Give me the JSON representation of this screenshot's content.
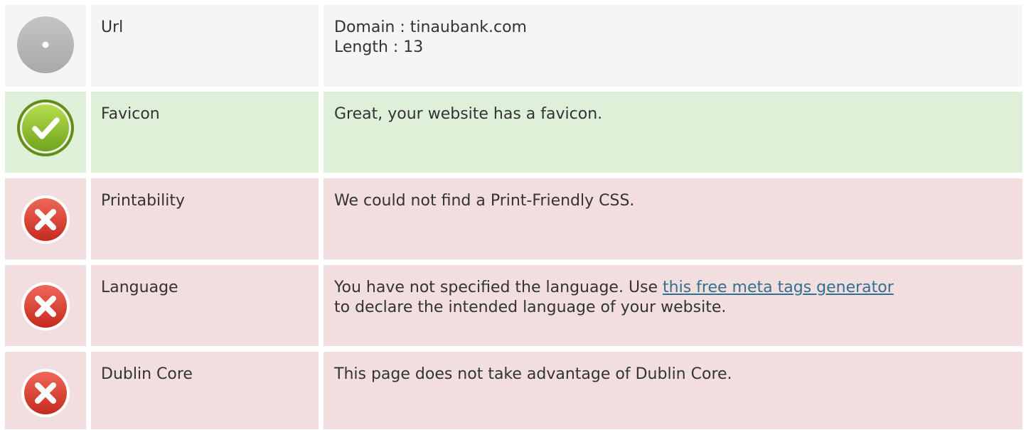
{
  "rows": [
    {
      "status": "neutral",
      "icon": "neutral-disc-icon",
      "label": "Url",
      "value_lines": [
        "Domain : tinaubank.com",
        "Length : 13"
      ]
    },
    {
      "status": "pass",
      "icon": "check-icon",
      "label": "Favicon",
      "value": "Great, your website has a favicon."
    },
    {
      "status": "fail",
      "icon": "error-x-icon",
      "label": "Printability",
      "value": "We could not find a Print-Friendly CSS."
    },
    {
      "status": "fail",
      "icon": "error-x-icon",
      "label": "Language",
      "value_before": "You have not specified the language. Use ",
      "link_text": "this free meta tags generator",
      "value_after": "to declare the intended language of your website."
    },
    {
      "status": "fail",
      "icon": "error-x-icon",
      "label": "Dublin Core",
      "value": "This page does not take advantage of Dublin Core."
    }
  ],
  "colors": {
    "neutral_bg": "#f5f5f5",
    "pass_bg": "#dff0d8",
    "fail_bg": "#f2dede",
    "link": "#31708f"
  }
}
